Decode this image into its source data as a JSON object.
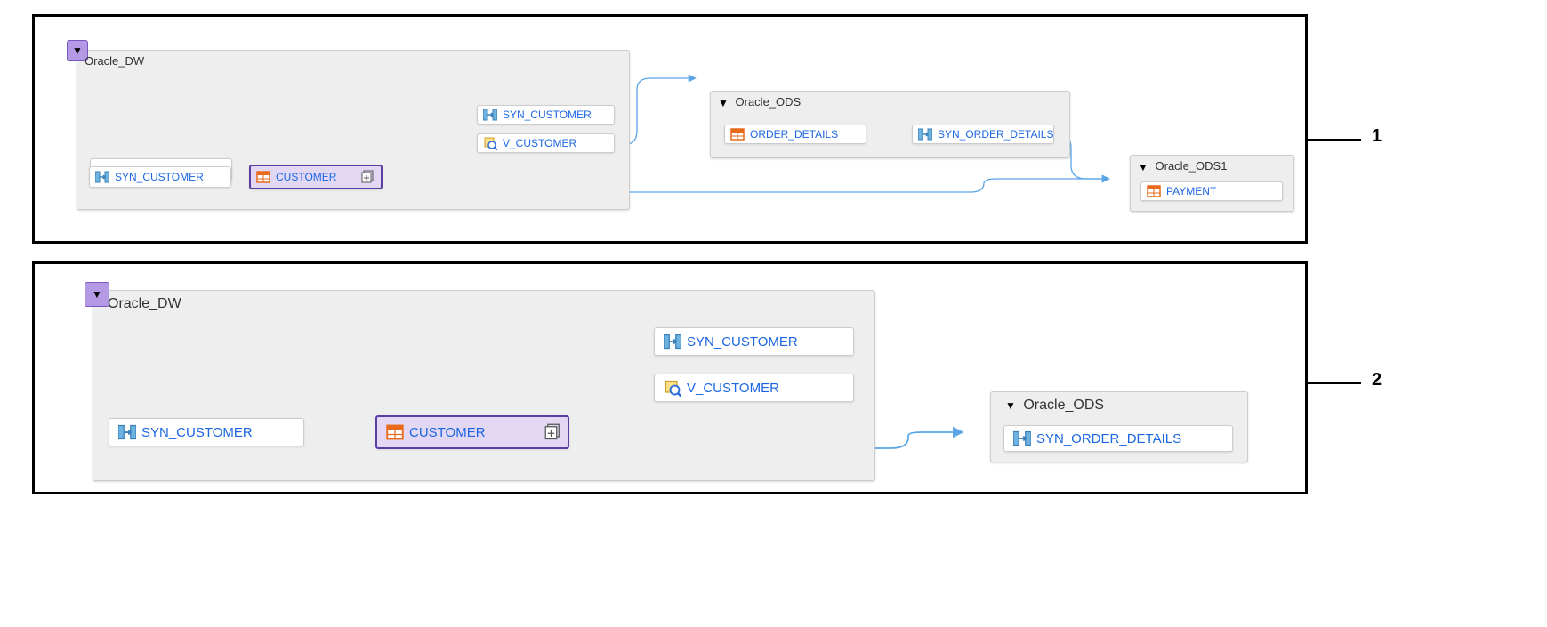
{
  "callouts": {
    "p1": "1",
    "p2": "2"
  },
  "panel1": {
    "group_dw": {
      "title": "Oracle_DW",
      "nodes": {
        "syn_customer_src": "SYN_CUSTOMER",
        "customer": "CUSTOMER",
        "syn_customer_dst": "SYN_CUSTOMER",
        "v_customer": "V_CUSTOMER"
      }
    },
    "group_ods": {
      "title": "Oracle_ODS",
      "nodes": {
        "order_details": "ORDER_DETAILS",
        "syn_order_details": "SYN_ORDER_DETAILS"
      }
    },
    "group_ods1": {
      "title": "Oracle_ODS1",
      "nodes": {
        "payment": "PAYMENT"
      }
    }
  },
  "panel2": {
    "group_dw": {
      "title": "Oracle_DW",
      "nodes": {
        "syn_customer_src": "SYN_CUSTOMER",
        "customer": "CUSTOMER",
        "syn_customer_dst": "SYN_CUSTOMER",
        "v_customer": "V_CUSTOMER"
      }
    },
    "group_ods": {
      "title": "Oracle_ODS",
      "nodes": {
        "syn_order_details": "SYN_ORDER_DETAILS"
      }
    }
  }
}
